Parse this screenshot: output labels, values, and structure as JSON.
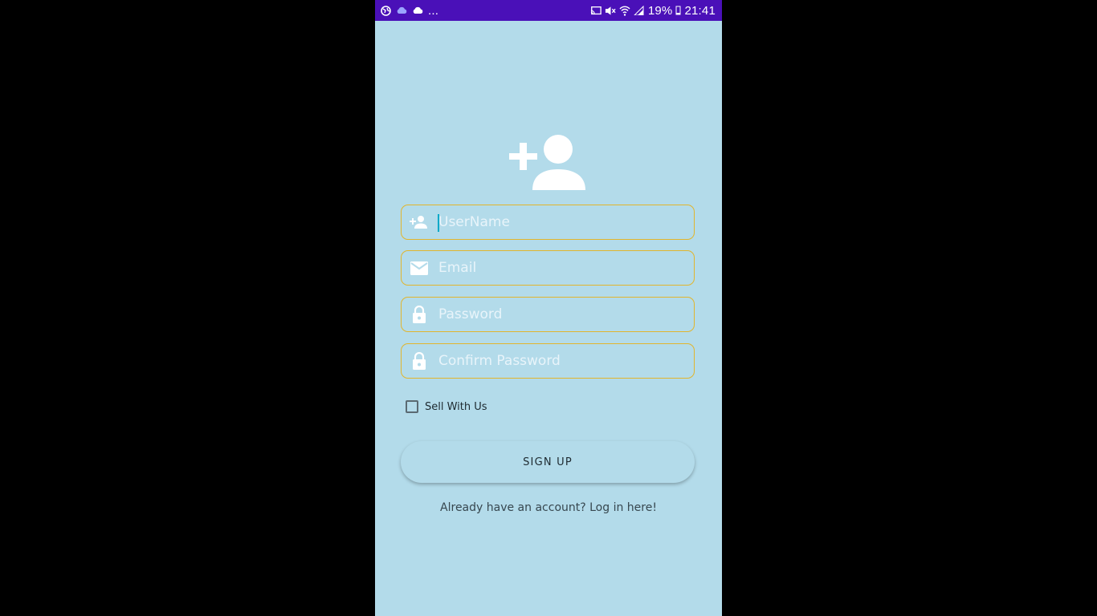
{
  "status_bar": {
    "left_icons": [
      "globe-icon",
      "cloud-icon",
      "cloud-icon"
    ],
    "overflow": "...",
    "battery_percent": "19%",
    "time": "21:41",
    "background_color": "#4a10b8"
  },
  "form": {
    "username": {
      "placeholder": "UserName",
      "icon": "add-user-icon"
    },
    "email": {
      "placeholder": "Email",
      "icon": "mail-icon"
    },
    "password": {
      "placeholder": "Password",
      "icon": "lock-icon"
    },
    "confirm_password": {
      "placeholder": "Confirm Password",
      "icon": "lock-icon"
    },
    "sell_with_us_label": "Sell With Us",
    "sell_with_us_checked": false,
    "signup_label": "SIGN UP",
    "login_link": "Already have an account? Log in here!"
  },
  "colors": {
    "background": "#b3dbea",
    "field_border": "#e1b52d",
    "caret": "#00a9c8"
  }
}
